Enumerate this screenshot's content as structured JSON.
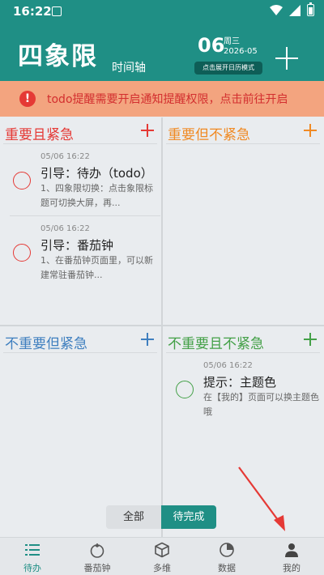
{
  "status_bar": {
    "time": "16:22"
  },
  "header": {
    "title": "四象限",
    "subtitle": "时间轴",
    "day": "06",
    "weekday": "周三",
    "year_month": "2026-05",
    "calendar_button": "点击展开日历模式"
  },
  "alert": {
    "text": "todo提醒需要开启通知提醒权限，点击前往开启"
  },
  "quadrants": {
    "q1": {
      "title": "重要且紧急",
      "color": "#e53935",
      "tasks": [
        {
          "time": "05/06 16:22",
          "title": "引导：待办（todo）",
          "desc": "1、四象限切换：点击象限标题可切换大屏，再..."
        },
        {
          "time": "05/06 16:22",
          "title": "引导：番茄钟",
          "desc": "1、在番茄钟页面里，可以新建常驻番茄钟..."
        }
      ]
    },
    "q2": {
      "title": "重要但不紧急",
      "color": "#f08a24"
    },
    "q3": {
      "title": "不重要但紧急",
      "color": "#3f7fbf"
    },
    "q4": {
      "title": "不重要且不紧急",
      "color": "#43a047",
      "tasks": [
        {
          "time": "05/06 16:22",
          "title": "提示：主题色",
          "desc": "在【我的】页面可以换主题色哦"
        }
      ]
    }
  },
  "filter": {
    "all": "全部",
    "pending": "待完成"
  },
  "tabbar": {
    "items": [
      {
        "label": "待办",
        "icon": "todo-list-icon"
      },
      {
        "label": "番茄钟",
        "icon": "tomato-icon"
      },
      {
        "label": "多维",
        "icon": "cube-icon"
      },
      {
        "label": "数据",
        "icon": "pie-chart-icon"
      },
      {
        "label": "我的",
        "icon": "person-icon"
      }
    ]
  },
  "colors": {
    "accent": "#1f8f85",
    "alert_bg": "#f3a47f",
    "alert_text": "#d32f2f",
    "annotation_arrow": "#e53935"
  }
}
